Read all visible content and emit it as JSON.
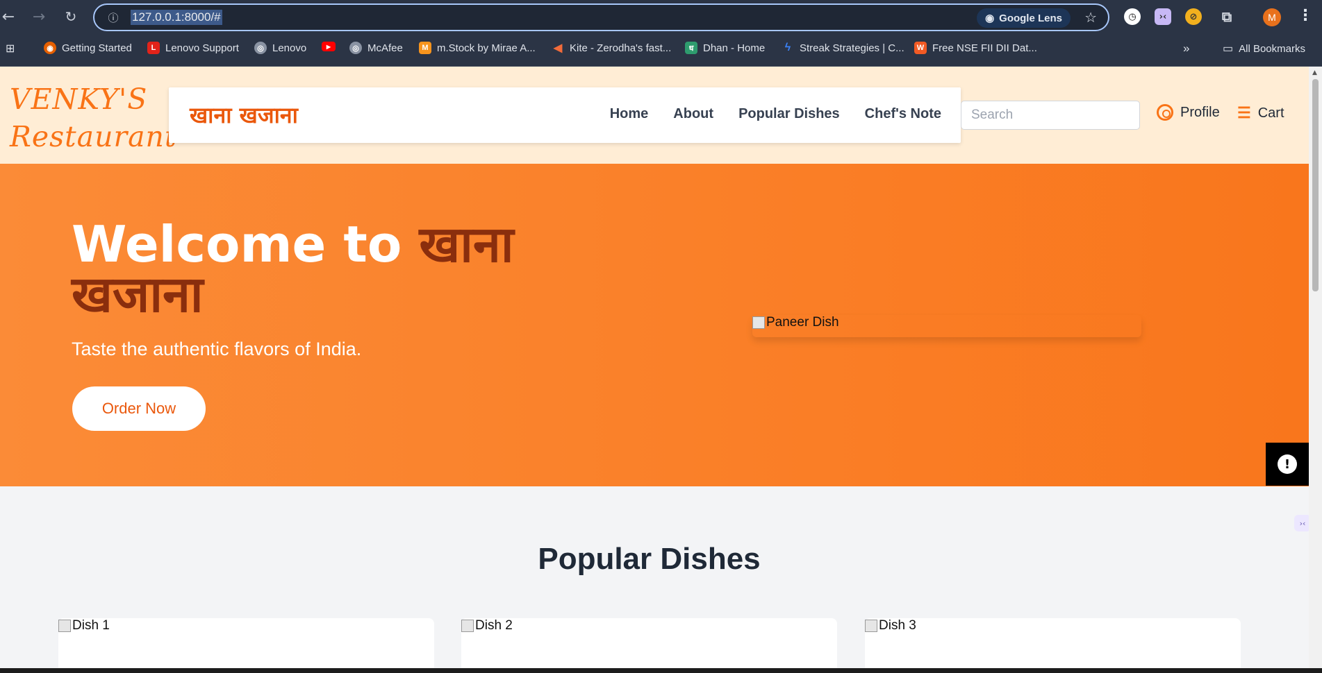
{
  "browser": {
    "url": "127.0.0.1:8000/#",
    "lens_label": "Google Lens",
    "profile_initial": "M",
    "bookmarks": [
      {
        "label": "Getting Started"
      },
      {
        "label": "Lenovo Support"
      },
      {
        "label": "Lenovo"
      },
      {
        "label": ""
      },
      {
        "label": "McAfee"
      },
      {
        "label": "m.Stock by Mirae A..."
      },
      {
        "label": "Kite - Zerodha's fast..."
      },
      {
        "label": "Dhan - Home"
      },
      {
        "label": "Streak Strategies | C..."
      },
      {
        "label": "Free NSE FII DII Dat..."
      }
    ],
    "more_label": "»",
    "all_bookmarks": "All Bookmarks"
  },
  "site": {
    "brand_line1": "VENKY'S",
    "brand_line2": "Restaurant",
    "nav_logo": "खाना खजाना",
    "nav": [
      "Home",
      "About",
      "Popular Dishes",
      "Chef's Note"
    ],
    "search_placeholder": "Search",
    "profile_label": "Profile",
    "cart_label": "Cart"
  },
  "hero": {
    "title_prefix": "Welcome to ",
    "title_accent": "खाना खजाना",
    "subtitle": "Taste the authentic flavors of India.",
    "cta": "Order Now",
    "image_alt": "Paneer Dish"
  },
  "popular": {
    "title": "Popular Dishes",
    "dishes": [
      {
        "alt": "Dish 1"
      },
      {
        "alt": "Dish 2"
      },
      {
        "alt": "Dish 3"
      }
    ]
  },
  "colors": {
    "accent": "#f97316",
    "accent_dark": "#8a2e0d",
    "header_bg": "#ffedd5"
  }
}
